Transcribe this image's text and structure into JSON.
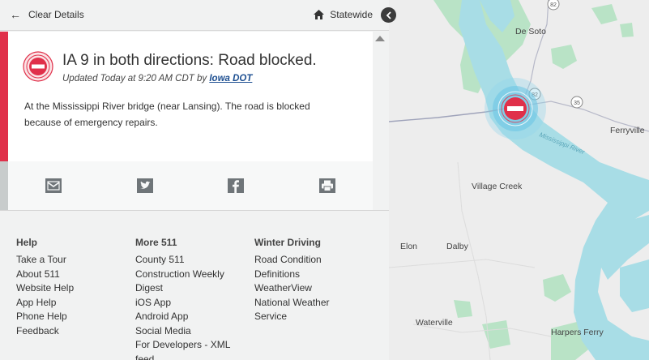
{
  "topbar": {
    "back_label": "Clear Details",
    "statewide_label": "Statewide"
  },
  "event": {
    "title": "IA 9 in both directions: Road blocked.",
    "updated_prefix": "Updated Today at 9:20 AM CDT by",
    "source": "Iowa DOT",
    "description": "At the Mississippi River bridge (near Lansing). The road is blocked because of emergency repairs.",
    "status_color": "#e0304a"
  },
  "share": {
    "icons": [
      "email-icon",
      "twitter-icon",
      "facebook-icon",
      "print-icon"
    ]
  },
  "footer": {
    "help": {
      "heading": "Help",
      "links": [
        "Take a Tour",
        "About 511",
        "Website Help",
        "App Help",
        "Phone Help",
        "Feedback"
      ]
    },
    "more": {
      "heading": "More 511",
      "links": [
        "County 511",
        "Construction Weekly Digest",
        "iOS App",
        "Android App",
        "Social Media",
        "For Developers - XML feed"
      ]
    },
    "winter": {
      "heading": "Winter Driving",
      "links": [
        "Road Condition Definitions",
        "WeatherView",
        "National Weather Service"
      ]
    }
  },
  "map": {
    "places": [
      "De Soto",
      "Ferryville",
      "Village Creek",
      "Elon",
      "Dalby",
      "Waterville",
      "Harpers Ferry"
    ],
    "route_shields": [
      "82",
      "82",
      "35"
    ],
    "river_label": "Mississippi River",
    "water_color": "#a8dde6",
    "land_color": "#ededed",
    "park_color": "#b9e3c6"
  }
}
